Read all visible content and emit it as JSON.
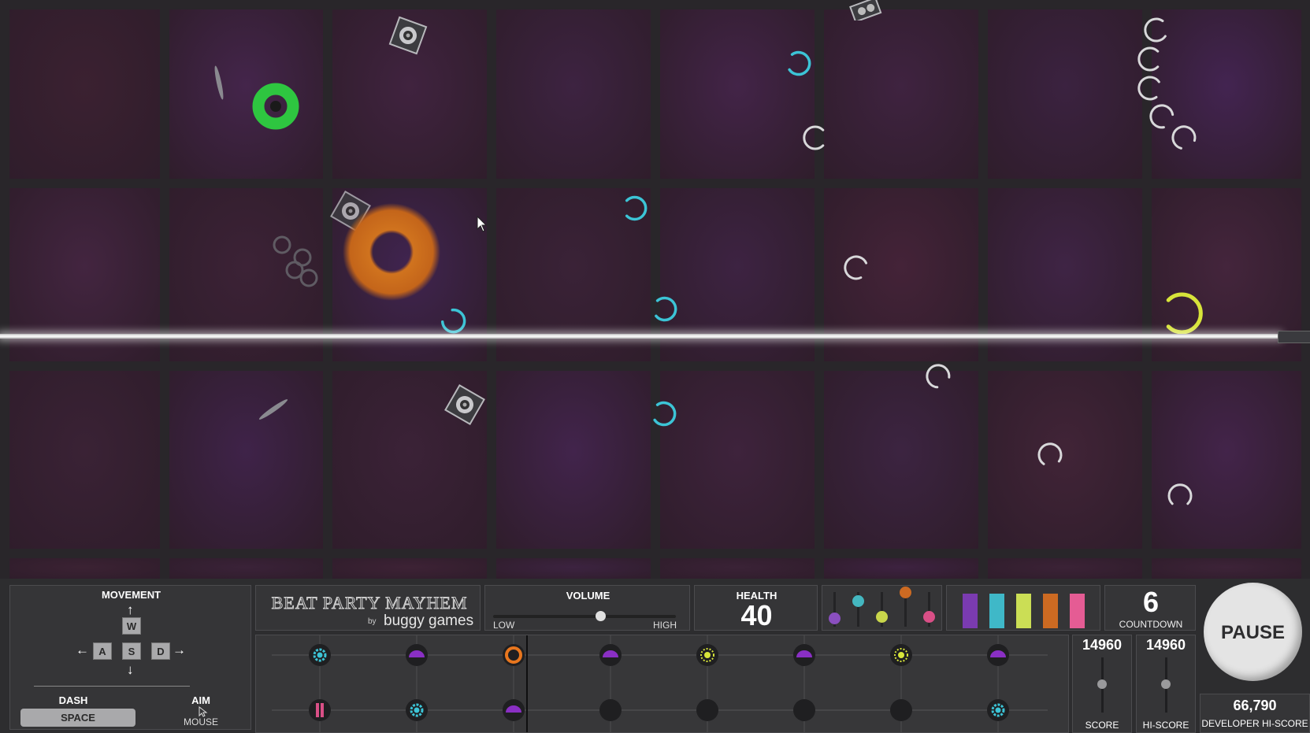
{
  "controls": {
    "movement_label": "MOVEMENT",
    "key_w": "W",
    "key_a": "A",
    "key_s": "S",
    "key_d": "D",
    "dash_label": "DASH",
    "dash_key": "SPACE",
    "aim_label": "AIM",
    "aim_key": "MOUSE"
  },
  "logo": {
    "title": "BEAT PARTY MAYHEM",
    "by": "by",
    "studio": "buggy games"
  },
  "volume": {
    "label": "VOLUME",
    "low": "LOW",
    "high": "HIGH",
    "level": 0.59
  },
  "health": {
    "label": "HEALTH",
    "value": "40"
  },
  "mixer": {
    "colors": [
      "#8a4fbf",
      "#44b7c0",
      "#c9d64b",
      "#cc6a22",
      "#d94f86"
    ],
    "levels": [
      0.25,
      0.75,
      0.3,
      1.0,
      0.3
    ]
  },
  "palette": {
    "colors": [
      "#7a3bb0",
      "#3fb8c8",
      "#cbde55",
      "#cc6a22",
      "#e55c94"
    ]
  },
  "countdown": {
    "value": "6",
    "label": "COUNTDOWN"
  },
  "score": {
    "value": "14960",
    "label": "SCORE"
  },
  "hiscore": {
    "value": "14960",
    "label": "HI-SCORE"
  },
  "pause": {
    "label": "PAUSE"
  },
  "dev_hiscore": {
    "value": "66,790",
    "label": "DEVELOPER HI-SCORE"
  },
  "sequencer": {
    "row1": [
      "cyan-gear",
      "purple-dome",
      "orange-ring",
      "purple-dome",
      "yellow-sun",
      "purple-dome",
      "yellow-sun",
      "purple-dome"
    ],
    "row2": [
      "pink-bars",
      "cyan-gear",
      "purple-dome",
      "empty",
      "empty",
      "empty",
      "empty",
      "cyan-gear"
    ]
  },
  "icons": {
    "cursor": "cursor-icon",
    "mouse": "mouse-icon",
    "speaker": "speaker-icon",
    "player": "green-ring-player",
    "hazard": "orange-ring-hazard"
  }
}
